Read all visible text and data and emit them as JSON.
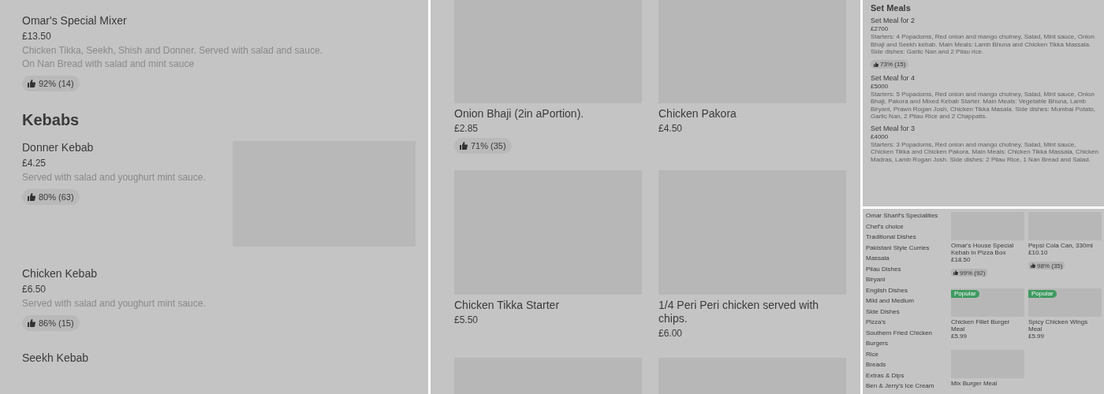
{
  "menu_list": {
    "entries": [
      {
        "kind": "item",
        "name": "Omar's Special Mixer",
        "price": "£13.50",
        "description": [
          "Chicken Tikka, Seekh, Shish and Donner. Served with salad and sauce.",
          "On Nan Bread with salad and mint sauce"
        ],
        "rating": "92% (14)",
        "has_image": false
      },
      {
        "kind": "heading",
        "title": "Kebabs"
      },
      {
        "kind": "item",
        "name": "Donner Kebab",
        "price": "£4.25",
        "description": [
          "Served with salad and youghurt mint sauce."
        ],
        "rating": "80% (63)",
        "has_image": true
      },
      {
        "kind": "item",
        "name": "Chicken Kebab",
        "price": "£6.50",
        "description": [
          "Served with salad and youghurt mint sauce."
        ],
        "rating": "86% (15)",
        "has_image": false
      },
      {
        "kind": "item",
        "name": "Seekh Kebab",
        "has_image": false
      }
    ]
  },
  "menu_grid": {
    "cards": [
      {
        "kind": "item",
        "name": "Onion Bhaji (2in aPortion).",
        "price": "£2.85",
        "rating": "71% (35)"
      },
      {
        "kind": "item",
        "name": "Chicken Pakora",
        "price": "£4.50"
      },
      {
        "kind": "item",
        "name": "Chicken Tikka Starter",
        "price": "£5.50"
      },
      {
        "kind": "item",
        "name": "1/4 Peri  Peri chicken served with chips.",
        "price": "£6.00"
      },
      {
        "kind": "picture"
      },
      {
        "kind": "picture"
      }
    ]
  },
  "set_meals": {
    "title": "Set Meals",
    "items": [
      {
        "name": "Set Meal for 2",
        "price": "£2700",
        "description": "Starters: 4 Popadoms, Red onion and mango chutney, Salad, Mint sauce, Onion Bhaji and Seekh kebab. Main Meals: Lamb Bhuna and Chicken Tikka Massala. Side dishes: Garlic Nan and 2 Pilau rice.",
        "rating": "73% (15)"
      },
      {
        "name": "Set Meal for 4",
        "price": "£5000",
        "description": "Starters: 5 Popadoms, Red onion and mango chutney, Salad, Mint sauce, Onion Bhaji, Pakora and Mixed Kebab Starter. Main Meals: Vegetable Bhuna, Lamb Biryani, Prawn Rogan Josh, Chicken Tikka Masala. Side dishes: Mumbai Potato, Garlic Nan, 2 Pilau Rice and 2 Chappatis."
      },
      {
        "name": "Set Meal for 3",
        "price": "£4000",
        "description": "Starters: 3 Popadoms, Red onion and mango chutney, Salad, Mint sauce, Chicken Tikka and Chicken Pakora. Main Meals: Chicken Tikka Massala, Chicken Madras, Lamb Rogan Josh. Side dishes: 2 Pilau Rice, 1 Nan Bread and Salad."
      }
    ]
  },
  "category_page": {
    "categories": [
      "Omar Sharif's Specialities",
      "Chef's choice",
      "Traditional Dishes",
      "Pakistani Style Curries",
      "Massala",
      "Pilau Dishes",
      "Biryani",
      "English Dishes",
      "Mild and Medium",
      "Side Dishes",
      "Pizza's",
      "Southern Fried Chicken",
      "Burgers",
      "Rice",
      "Breads",
      "Extras & Dips",
      "Ben & Jerry's Ice Cream"
    ],
    "offers": [
      {
        "name": "Omar's House Special Kebab in Pizza Box",
        "price": "£18.50",
        "rating": "99% (92)"
      },
      {
        "name": "Pepsi Cola Can, 330ml",
        "price": "£10.10",
        "rating": "98% (35)"
      },
      {
        "name": "Chicken Fillet Burger Meal",
        "price": "£5.99",
        "badge": "Popular"
      },
      {
        "name": "Spicy Chicken Wings Meal",
        "price": "£5.99",
        "badge": "Popular"
      },
      {
        "name": "Mix Burger Meal"
      }
    ]
  }
}
